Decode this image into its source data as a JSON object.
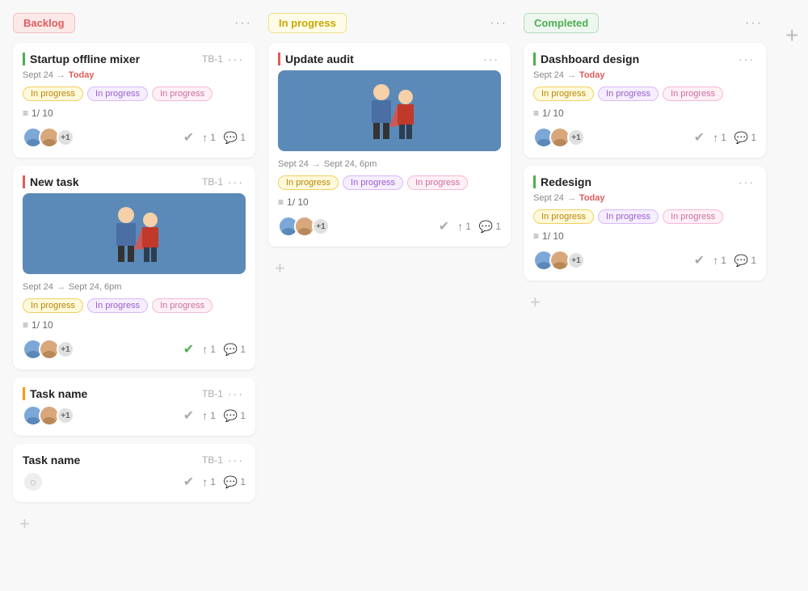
{
  "columns": [
    {
      "id": "backlog",
      "title": "Backlog",
      "badgeClass": "badge-backlog",
      "cards": [
        {
          "id": "card-startup",
          "title": "Startup offline mixer",
          "taskId": "TB-1",
          "date": "Sept 24",
          "dateArrow": "→",
          "dateEnd": "Today",
          "dateEndClass": "date-today",
          "tags": [
            {
              "label": "In progress",
              "cls": "tag-yellow"
            },
            {
              "label": "In progress",
              "cls": "tag-purple"
            },
            {
              "label": "In progress",
              "cls": "tag-pink"
            }
          ],
          "checklist": "1/ 10",
          "hasImage": false,
          "avatarCount": "+1",
          "checkGreen": false,
          "uploadCount": "1",
          "commentCount": "1",
          "leftBorder": "left-border-green"
        },
        {
          "id": "card-newtask",
          "title": "New task",
          "taskId": "TB-1",
          "date": "Sept 24",
          "dateArrow": "→",
          "dateEnd": "Sept 24, 6pm",
          "dateEndClass": "",
          "tags": [
            {
              "label": "In progress",
              "cls": "tag-yellow"
            },
            {
              "label": "In progress",
              "cls": "tag-purple"
            },
            {
              "label": "In progress",
              "cls": "tag-pink"
            }
          ],
          "checklist": "1/ 10",
          "hasImage": true,
          "avatarCount": "+1",
          "checkGreen": true,
          "uploadCount": "1",
          "commentCount": "1",
          "leftBorder": "left-border-red"
        },
        {
          "id": "card-taskname1",
          "title": "Task name",
          "taskId": "TB-1",
          "date": "",
          "dateArrow": "",
          "dateEnd": "",
          "dateEndClass": "",
          "tags": [],
          "checklist": "",
          "hasImage": false,
          "avatarCount": "+1",
          "checkGreen": false,
          "uploadCount": "1",
          "commentCount": "1",
          "leftBorder": "left-border-orange"
        },
        {
          "id": "card-taskname2",
          "title": "Task name",
          "taskId": "TB-1",
          "date": "",
          "dateArrow": "",
          "dateEnd": "",
          "dateEndClass": "",
          "tags": [],
          "checklist": "",
          "hasImage": false,
          "avatarCount": "",
          "isGhost": true,
          "checkGreen": false,
          "uploadCount": "1",
          "commentCount": "1",
          "leftBorder": ""
        }
      ]
    },
    {
      "id": "inprogress",
      "title": "In progress",
      "badgeClass": "badge-inprogress",
      "cards": [
        {
          "id": "card-updateaudit",
          "title": "Update audit",
          "taskId": "",
          "date": "Sept 24",
          "dateArrow": "→",
          "dateEnd": "Sept 24, 6pm",
          "dateEndClass": "",
          "tags": [
            {
              "label": "In progress",
              "cls": "tag-yellow"
            },
            {
              "label": "In progress",
              "cls": "tag-purple"
            },
            {
              "label": "In progress",
              "cls": "tag-pink"
            }
          ],
          "checklist": "1/ 10",
          "hasImage": true,
          "avatarCount": "+1",
          "checkGreen": false,
          "uploadCount": "1",
          "commentCount": "1",
          "leftBorder": "left-border-red"
        }
      ]
    },
    {
      "id": "completed",
      "title": "Completed",
      "badgeClass": "badge-completed",
      "cards": [
        {
          "id": "card-dashboard",
          "title": "Dashboard design",
          "taskId": "",
          "date": "Sept 24",
          "dateArrow": "→",
          "dateEnd": "Today",
          "dateEndClass": "date-today",
          "tags": [
            {
              "label": "In progress",
              "cls": "tag-yellow"
            },
            {
              "label": "In progress",
              "cls": "tag-purple"
            },
            {
              "label": "In progress",
              "cls": "tag-pink"
            }
          ],
          "checklist": "1/ 10",
          "hasImage": false,
          "avatarCount": "+1",
          "checkGreen": false,
          "uploadCount": "1",
          "commentCount": "1",
          "leftBorder": "left-border-green"
        },
        {
          "id": "card-redesign",
          "title": "Redesign",
          "taskId": "",
          "date": "Sept 24",
          "dateArrow": "→",
          "dateEnd": "Today",
          "dateEndClass": "date-today",
          "tags": [
            {
              "label": "In progress",
              "cls": "tag-yellow"
            },
            {
              "label": "In progress",
              "cls": "tag-purple"
            },
            {
              "label": "In progress",
              "cls": "tag-pink"
            }
          ],
          "checklist": "1/ 10",
          "hasImage": false,
          "avatarCount": "+1",
          "checkGreen": false,
          "uploadCount": "1",
          "commentCount": "1",
          "leftBorder": "left-border-green"
        }
      ]
    }
  ],
  "labels": {
    "dots": "···",
    "plus": "+",
    "checkmark": "✓",
    "upload": "↑",
    "comment": "💬",
    "list": "≡",
    "add_task": "+"
  }
}
